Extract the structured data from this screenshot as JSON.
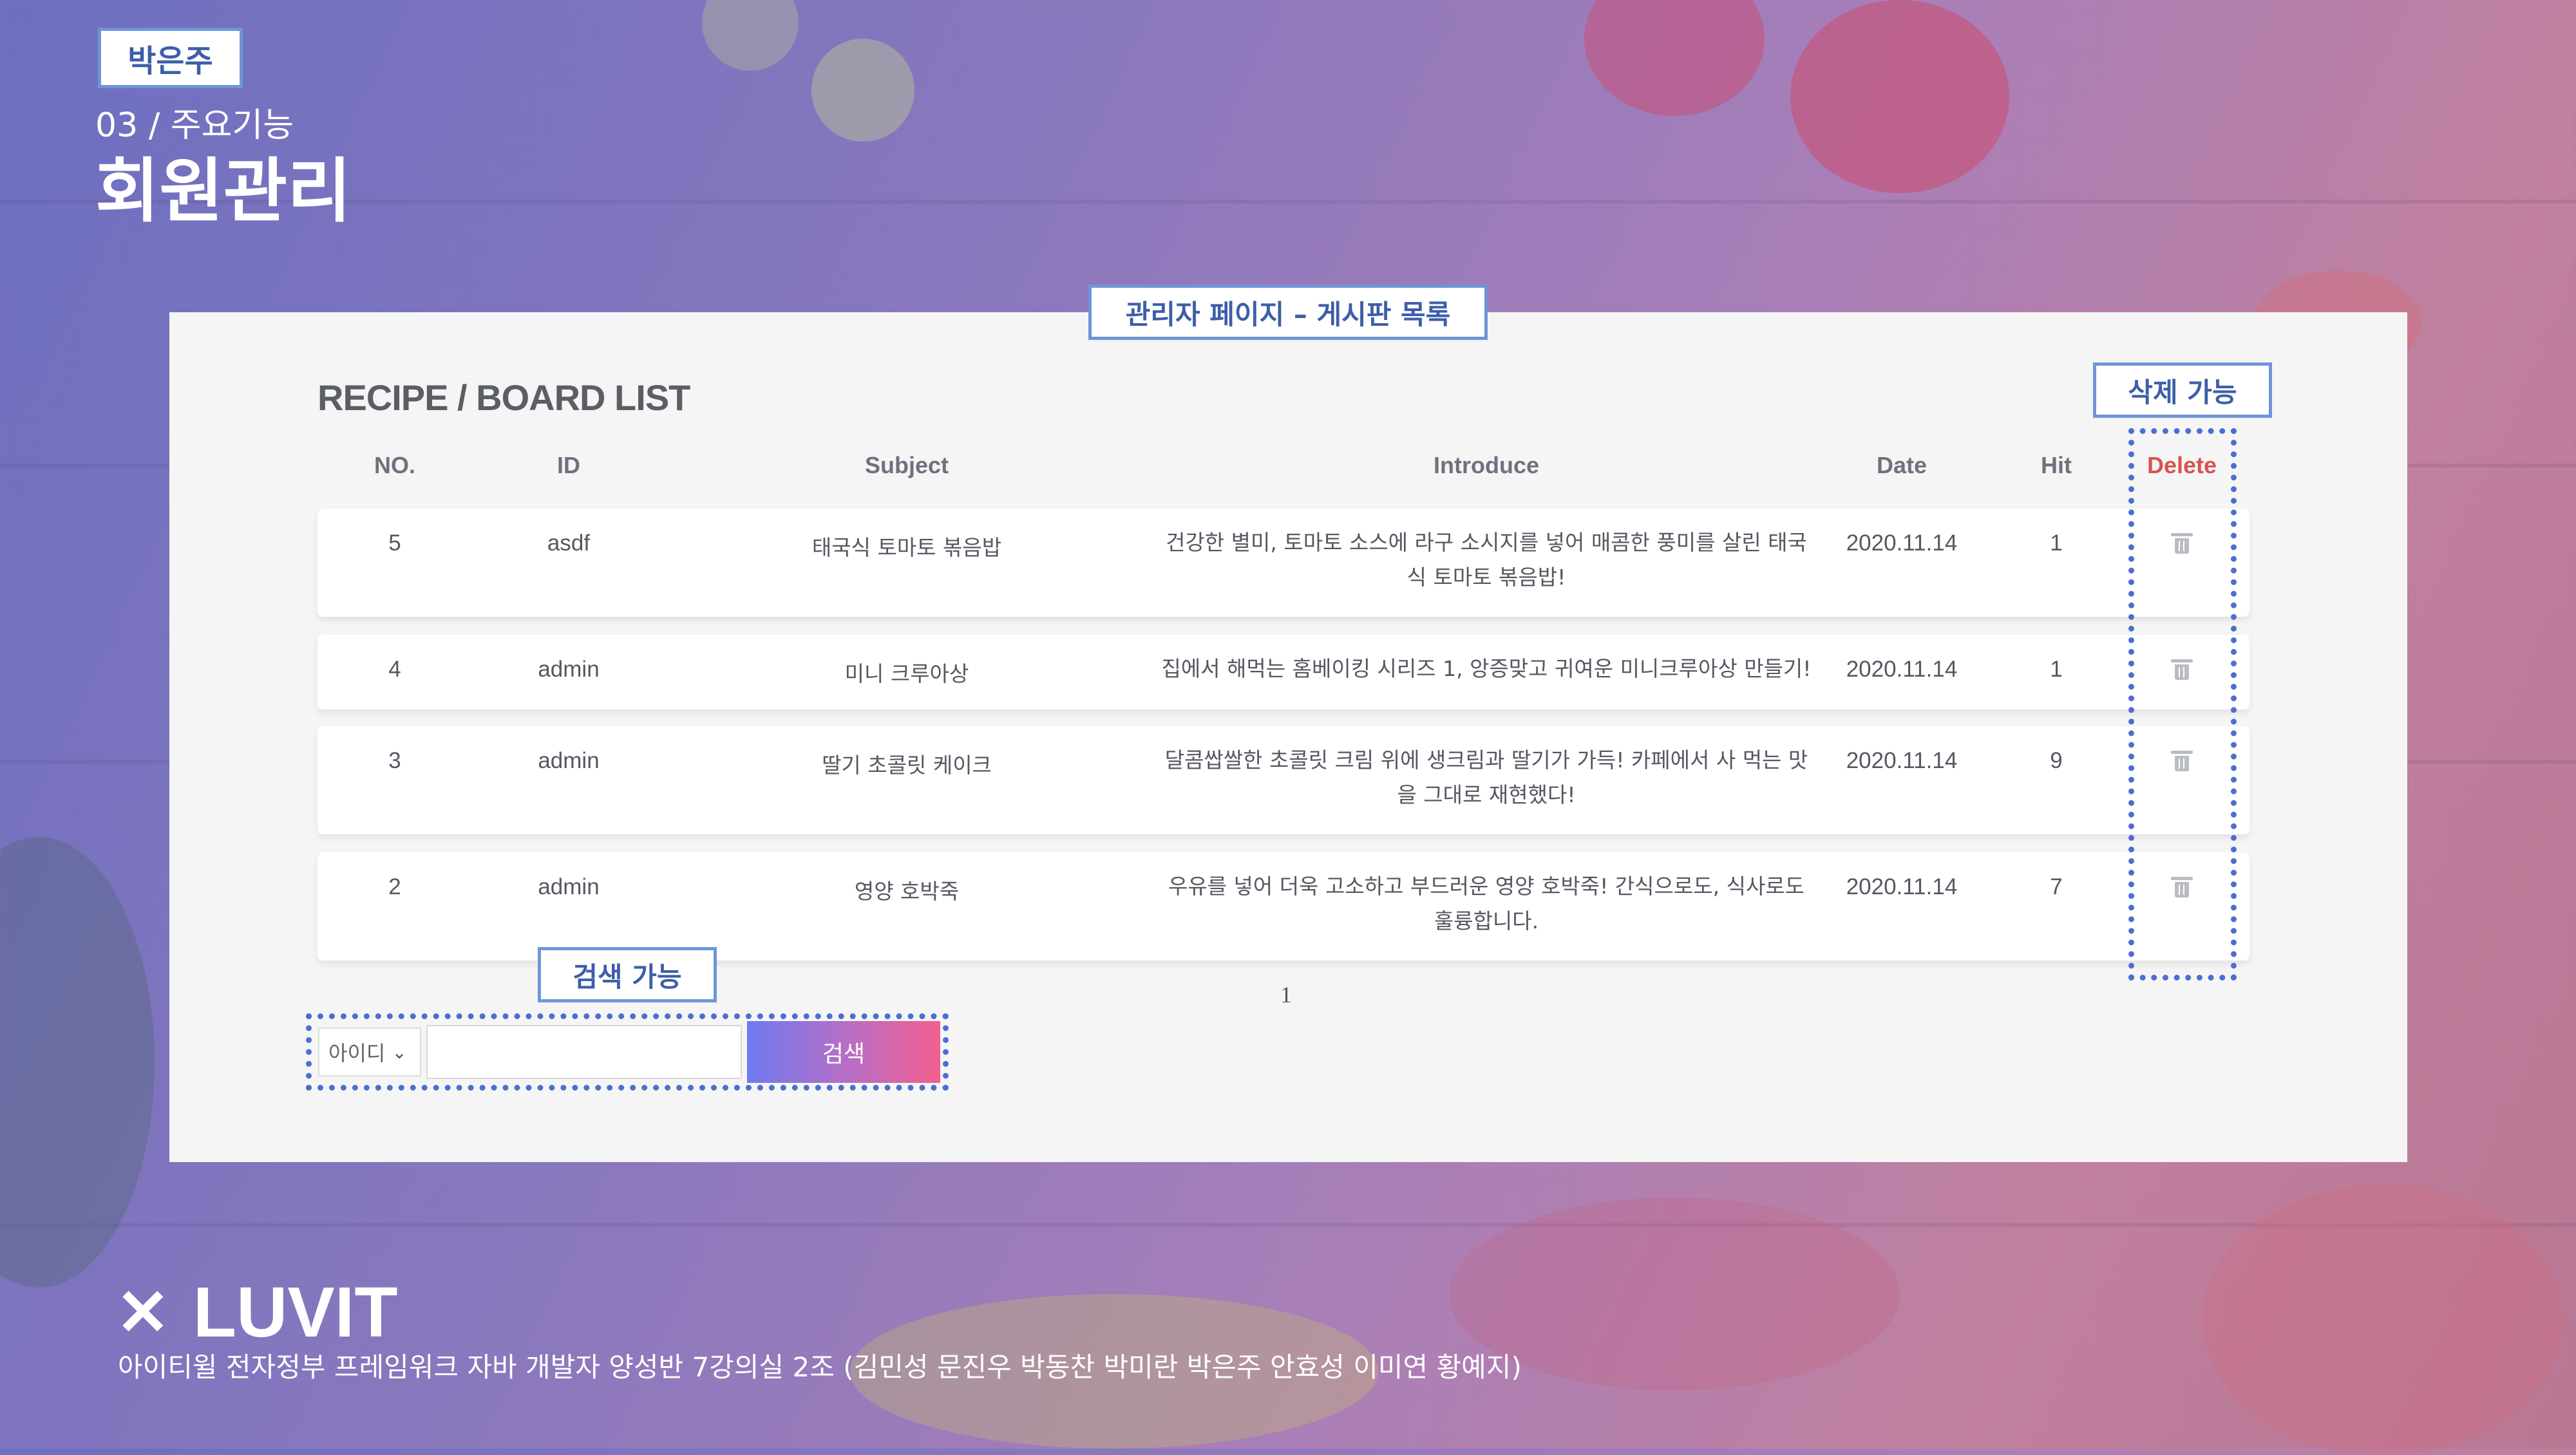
{
  "presenter": "박은주",
  "section": {
    "number": "03 / 주요기능",
    "title": "회원관리"
  },
  "callouts": {
    "page_label": "관리자 페이지 – 게시판 목록",
    "delete_label": "삭제 가능",
    "search_label": "검색 가능"
  },
  "board": {
    "title": "RECIPE / BOARD LIST",
    "columns": {
      "no": "NO.",
      "id": "ID",
      "subject": "Subject",
      "introduce": "Introduce",
      "date": "Date",
      "hit": "Hit",
      "delete": "Delete"
    },
    "rows": [
      {
        "no": "5",
        "id": "asdf",
        "subject": "태국식 토마토 볶음밥",
        "introduce": "건강한 별미, 토마토 소스에 라구 소시지를 넣어 매콤한 풍미를 살린 태국식 토마토 볶음밥!",
        "date": "2020.11.14",
        "hit": "1"
      },
      {
        "no": "4",
        "id": "admin",
        "subject": "미니 크루아상",
        "introduce": "집에서 해먹는 홈베이킹 시리즈 1, 앙증맞고 귀여운 미니크루아상 만들기!",
        "date": "2020.11.14",
        "hit": "1"
      },
      {
        "no": "3",
        "id": "admin",
        "subject": "딸기 초콜릿 케이크",
        "introduce": "달콤쌉쌀한 초콜릿 크림 위에 생크림과 딸기가 가득! 카페에서 사 먹는 맛을 그대로 재현했다!",
        "date": "2020.11.14",
        "hit": "9"
      },
      {
        "no": "2",
        "id": "admin",
        "subject": "영양 호박죽",
        "introduce": "우유를 넣어 더욱 고소하고 부드러운 영양 호박죽! 간식으로도, 식사로도 훌륭합니다.",
        "date": "2020.11.14",
        "hit": "7"
      }
    ],
    "pagination": "1",
    "search": {
      "select_value": "아이디",
      "button": "검색"
    }
  },
  "brand": {
    "name": "LUVIT",
    "icon": "utensils-cross-icon"
  },
  "footer": "아이티윌 전자정부 프레임워크 자바 개발자 양성반 7강의실 2조 (김민성 문진우 박동찬 박미란 박은주 안효성 이미연 황예지)",
  "colors": {
    "delete_header": "#d9534f",
    "callout_border": "#6f95d8",
    "dotted": "#4b6fcf"
  }
}
